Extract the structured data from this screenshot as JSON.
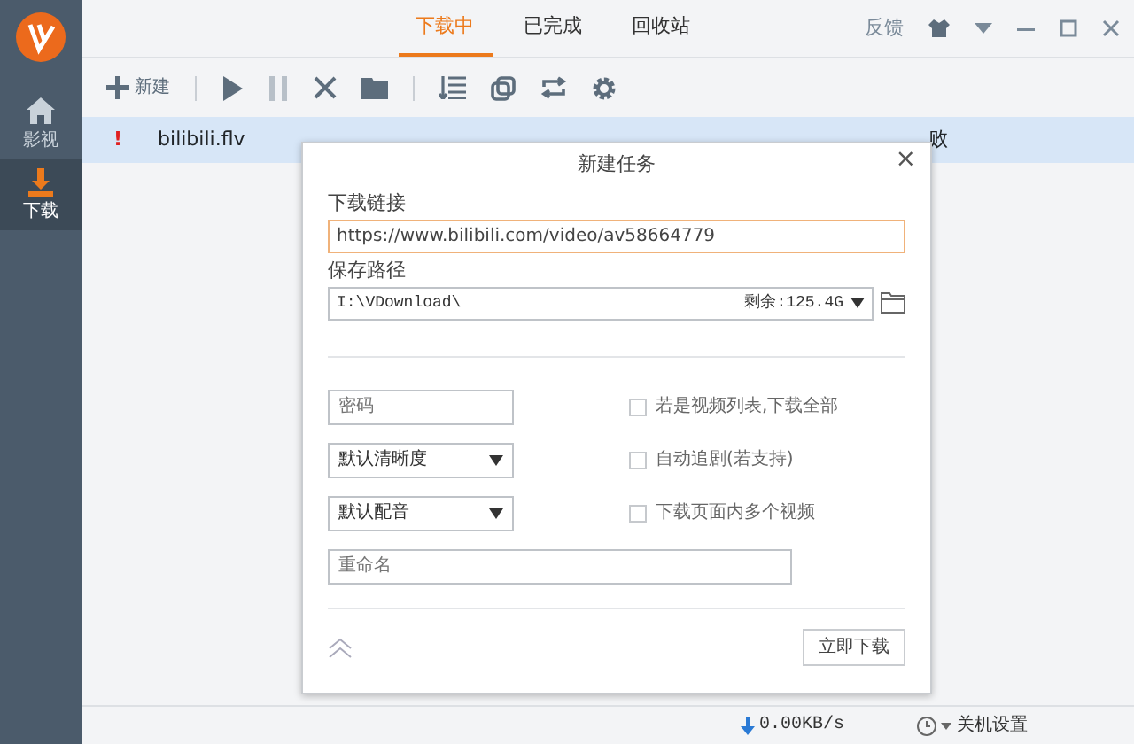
{
  "sidebar": {
    "items": [
      {
        "label": "影视",
        "kind": "home",
        "selected": false
      },
      {
        "label": "下载",
        "kind": "download",
        "selected": true
      }
    ]
  },
  "tabs": [
    {
      "label": "下载中",
      "selected": true
    },
    {
      "label": "已完成",
      "selected": false
    },
    {
      "label": "回收站",
      "selected": false
    }
  ],
  "title_bar": {
    "feedback": "反馈"
  },
  "toolbar": {
    "new_label": "新建"
  },
  "downloads": [
    {
      "name": "bilibili.flv",
      "status": "败",
      "mark": "!",
      "selected": true
    }
  ],
  "dialog": {
    "title": "新建任务",
    "close": "×",
    "url_label": "下载链接",
    "url": "https://www.bilibili.com/video/av58664779",
    "path_label": "保存路径",
    "path": "I:\\VDownload\\",
    "free_space": "剩余:125.4G",
    "password": {
      "placeholder": "密码"
    },
    "quality": "默认清晰度",
    "audio": "默认配音",
    "options": [
      {
        "label": "若是视频列表,下载全部",
        "checked": false
      },
      {
        "label": "自动追剧(若支持)",
        "checked": false
      },
      {
        "label": "下载页面内多个视频",
        "checked": false
      }
    ],
    "rename": {
      "placeholder": "重命名"
    },
    "submit": "立即下载"
  },
  "status_bar": {
    "speed": "0.00KB/s",
    "shutdown": "关机设置"
  }
}
